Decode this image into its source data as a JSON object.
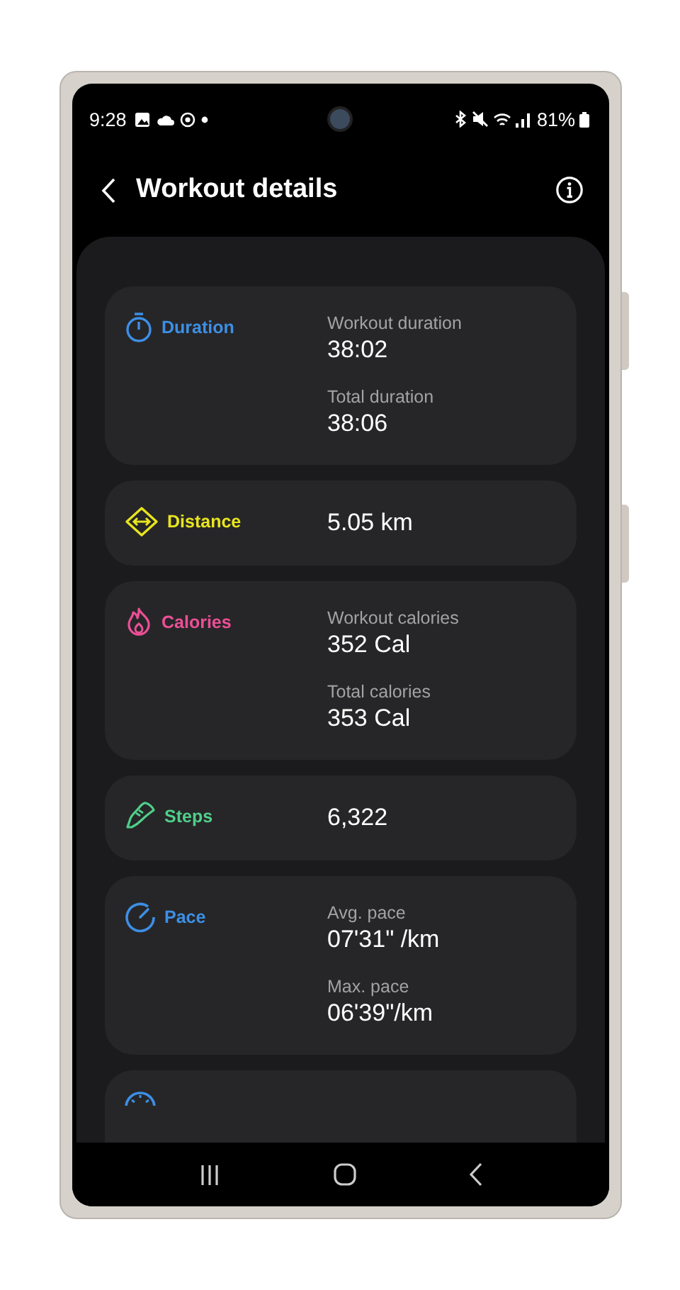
{
  "status_bar": {
    "time": "9:28",
    "battery": "81%"
  },
  "header": {
    "title": "Workout details"
  },
  "cards": [
    {
      "kind": "stopwatch",
      "label": "Duration",
      "color": "#3d8fe6",
      "metrics": [
        {
          "label": "Workout duration",
          "value": "38:02"
        },
        {
          "label": "Total duration",
          "value": "38:06"
        }
      ]
    },
    {
      "kind": "distance",
      "label": "Distance",
      "color": "#e8e41f",
      "metrics": [
        {
          "value": "5.05 km"
        }
      ]
    },
    {
      "kind": "flame",
      "label": "Calories",
      "color": "#ec4f96",
      "metrics": [
        {
          "label": "Workout calories",
          "value": "352 Cal"
        },
        {
          "label": "Total calories",
          "value": "353 Cal"
        }
      ]
    },
    {
      "kind": "shoe",
      "label": "Steps",
      "color": "#4fcf8a",
      "metrics": [
        {
          "value": "6,322"
        }
      ]
    },
    {
      "kind": "gauge",
      "label": "Pace",
      "color": "#3d8fe6",
      "metrics": [
        {
          "label": "Avg. pace",
          "value": "07'31\" /km"
        },
        {
          "label": "Max. pace",
          "value": "06'39\"/km"
        }
      ]
    },
    {
      "kind": "speed",
      "color": "#3d8fe6"
    }
  ]
}
